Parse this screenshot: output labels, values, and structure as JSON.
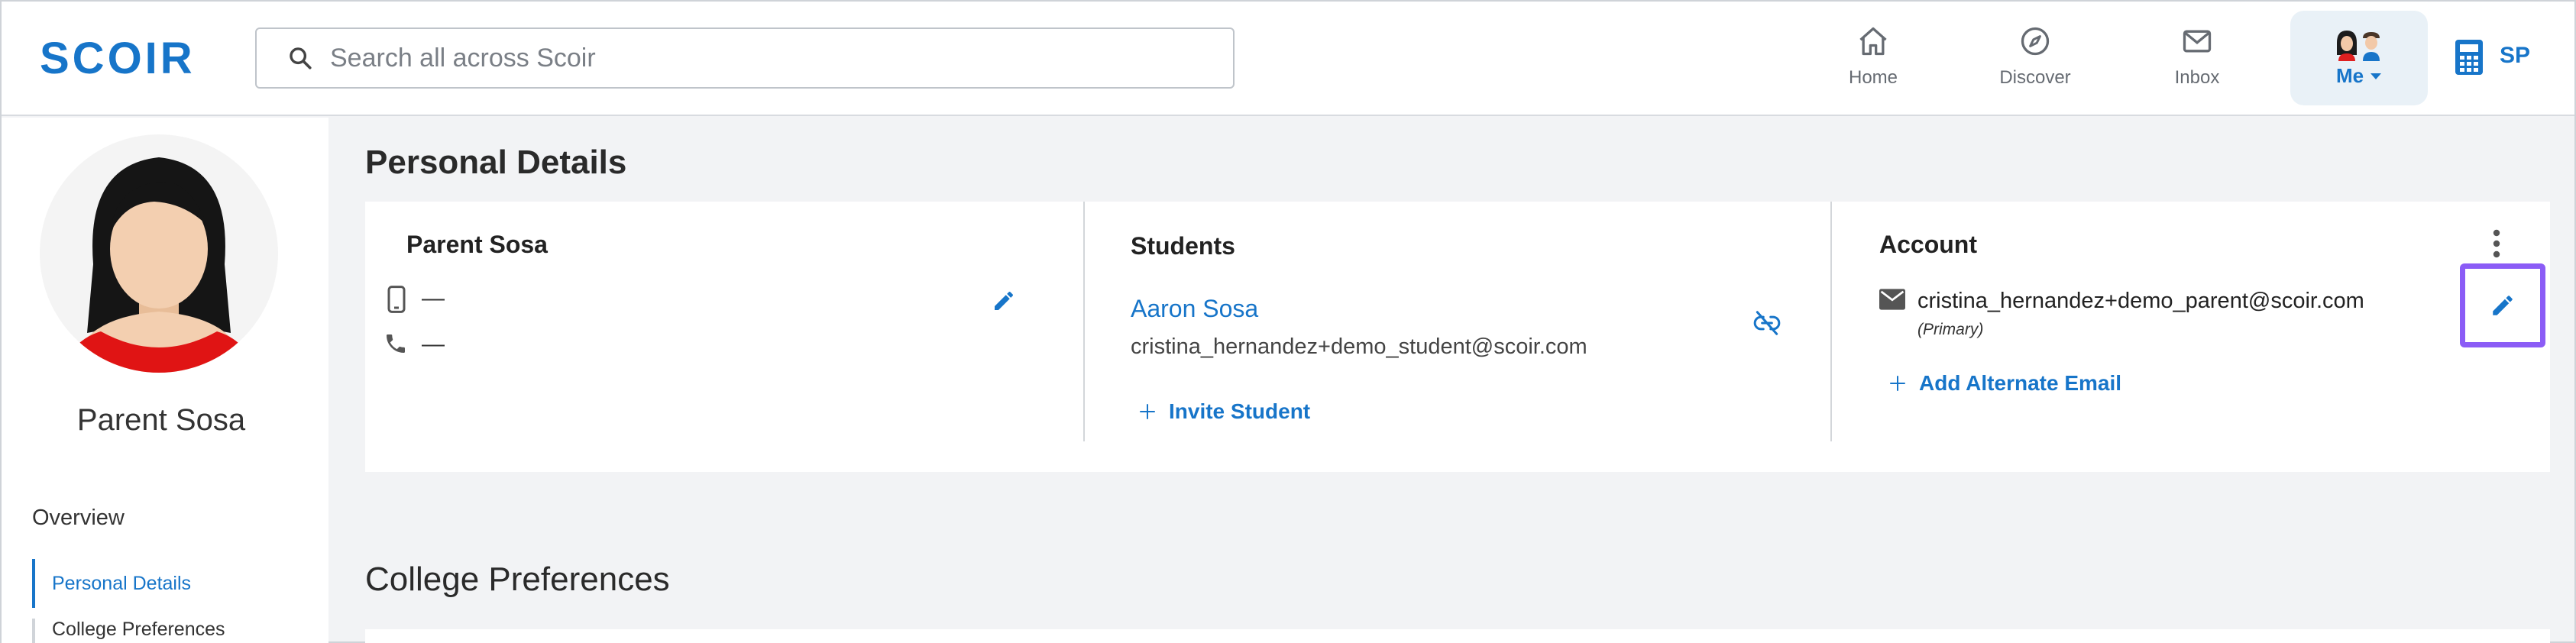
{
  "header": {
    "logo_text": "SCOIR",
    "search_placeholder": "Search all across Scoir",
    "nav": [
      {
        "label": "Home",
        "icon": "home-icon"
      },
      {
        "label": "Discover",
        "icon": "compass-icon"
      },
      {
        "label": "Inbox",
        "icon": "envelope-icon"
      }
    ],
    "me_label": "Me",
    "user_initials": "SP"
  },
  "sidebar": {
    "profile_name": "Parent Sosa",
    "overview_label": "Overview",
    "items": [
      {
        "label": "Personal Details",
        "active": true
      },
      {
        "label": "College Preferences",
        "active": false
      }
    ]
  },
  "main": {
    "personal_details_title": "Personal Details",
    "college_preferences_title": "College Preferences",
    "parent": {
      "name": "Parent Sosa",
      "mobile": "—",
      "phone": "—"
    },
    "students": {
      "title": "Students",
      "student_name": "Aaron Sosa",
      "student_email": "cristina_hernandez+demo_student@scoir.com",
      "invite_label": "Invite Student"
    },
    "account": {
      "title": "Account",
      "email": "cristina_hernandez+demo_parent@scoir.com",
      "primary_label": "(Primary)",
      "add_email_label": "Add Alternate Email"
    }
  },
  "colors": {
    "brand": "#1775c9",
    "highlight": "#8b5cf6",
    "background": "#f2f3f5"
  }
}
